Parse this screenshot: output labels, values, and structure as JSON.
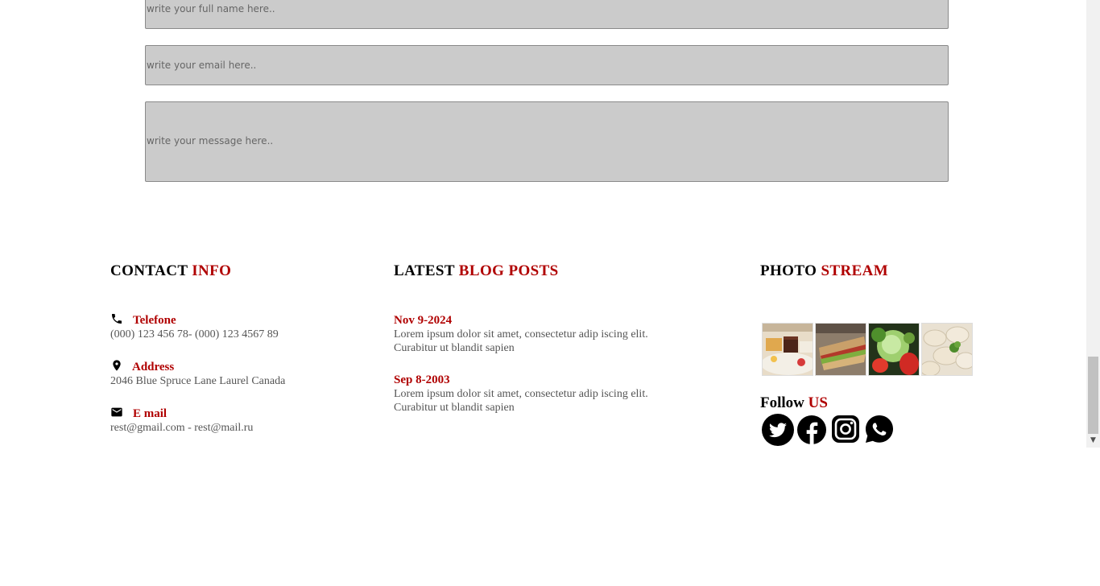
{
  "form": {
    "name_placeholder": "write your full name here..",
    "email_placeholder": "write your email here..",
    "message_placeholder": "write your message here.."
  },
  "contact_info": {
    "heading_a": "CONTACT",
    "heading_b": "INFO",
    "items": [
      {
        "icon": "phone-icon",
        "label": "Telefone",
        "value": "(000) 123 456 78- (000) 123 4567 89"
      },
      {
        "icon": "location-pin-icon",
        "label": "Address",
        "value": "2046 Blue Spruce Lane Laurel Canada"
      },
      {
        "icon": "mail-icon",
        "label": "E mail",
        "value": "rest@gmail.com - rest@mail.ru"
      }
    ]
  },
  "blog": {
    "heading_a": "LATEST",
    "heading_b": "BLOG POSTS",
    "posts": [
      {
        "date": "Nov 9-2024",
        "text": "Lorem ipsum dolor sit amet, consectetur adip iscing elit. Curabitur ut blandit sapien"
      },
      {
        "date": "Sep 8-2003",
        "text": "Lorem ipsum dolor sit amet, consectetur adip iscing elit. Curabitur ut blandit sapien"
      }
    ]
  },
  "photo_stream": {
    "heading_a": "PHOTO",
    "heading_b": "STREAM",
    "photos": [
      "dessert-photo",
      "sandwich-photo",
      "vegetables-photo",
      "dumplings-photo"
    ],
    "follow_a": "Follow",
    "follow_b": "US",
    "socials": [
      "twitter-icon",
      "facebook-icon",
      "instagram-icon",
      "whatsapp-icon"
    ]
  },
  "colors": {
    "accent": "#b00000",
    "field_bg": "#cbcbcb",
    "muted_text": "#555555"
  }
}
